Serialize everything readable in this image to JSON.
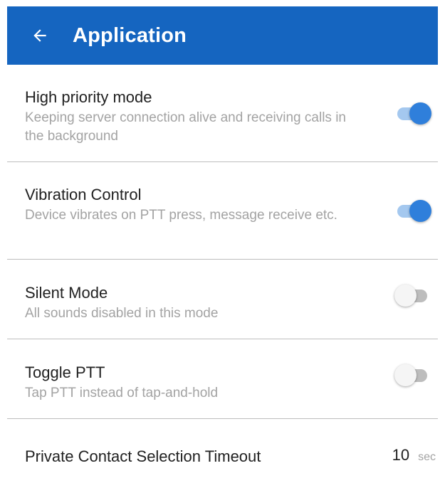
{
  "header": {
    "title": "Application",
    "back_icon": "arrow-left-icon",
    "color": "#1565c0"
  },
  "settings": [
    {
      "label": "High priority mode",
      "description": "Keeping server connection alive and receiving calls in the background",
      "enabled": true
    },
    {
      "label": "Vibration Control",
      "description": "Device vibrates on PTT press, message receive etc.",
      "enabled": true
    },
    {
      "label": "Silent Mode",
      "description": "All sounds disabled in this mode",
      "enabled": false
    },
    {
      "label": "Toggle PTT",
      "description": "Tap PTT instead of tap-and-hold",
      "enabled": false
    }
  ],
  "timeout": {
    "label": "Private Contact Selection Timeout",
    "value": "10",
    "unit": "sec"
  },
  "colors": {
    "switch_on_knob": "#2f7fdb",
    "switch_on_track": "#a4c8ef",
    "switch_off_knob": "#f5f5f5",
    "switch_off_track": "#bdbdbd"
  }
}
